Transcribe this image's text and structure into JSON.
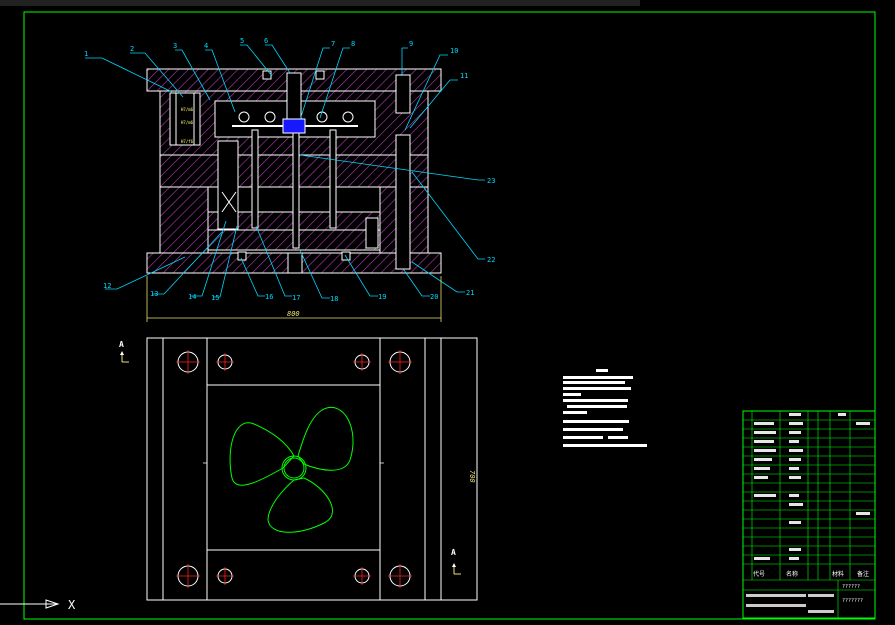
{
  "balloons": [
    "1",
    "2",
    "3",
    "4",
    "5",
    "6",
    "7",
    "8",
    "9",
    "10",
    "11",
    "12",
    "13",
    "14",
    "15",
    "16",
    "17",
    "18",
    "19",
    "20",
    "21",
    "22",
    "23"
  ],
  "dims": {
    "width": "800",
    "height": "700"
  },
  "section_marks": {
    "letter": "A"
  },
  "title_block": {
    "headers": [
      "代号",
      "名称",
      "材料",
      "备注"
    ],
    "signature": "??????",
    "drawing_no": "???????"
  },
  "ucs": {
    "x_label": "X"
  },
  "colors": {
    "background": "#000000",
    "outline": "#ffffff",
    "hatch": "#c040c0",
    "leader": "#00d8ff",
    "dimension": "#e8e070",
    "center": "#ff2020",
    "part": "#00ff00",
    "frame": "#00ff00",
    "gate": "#0000ff"
  }
}
